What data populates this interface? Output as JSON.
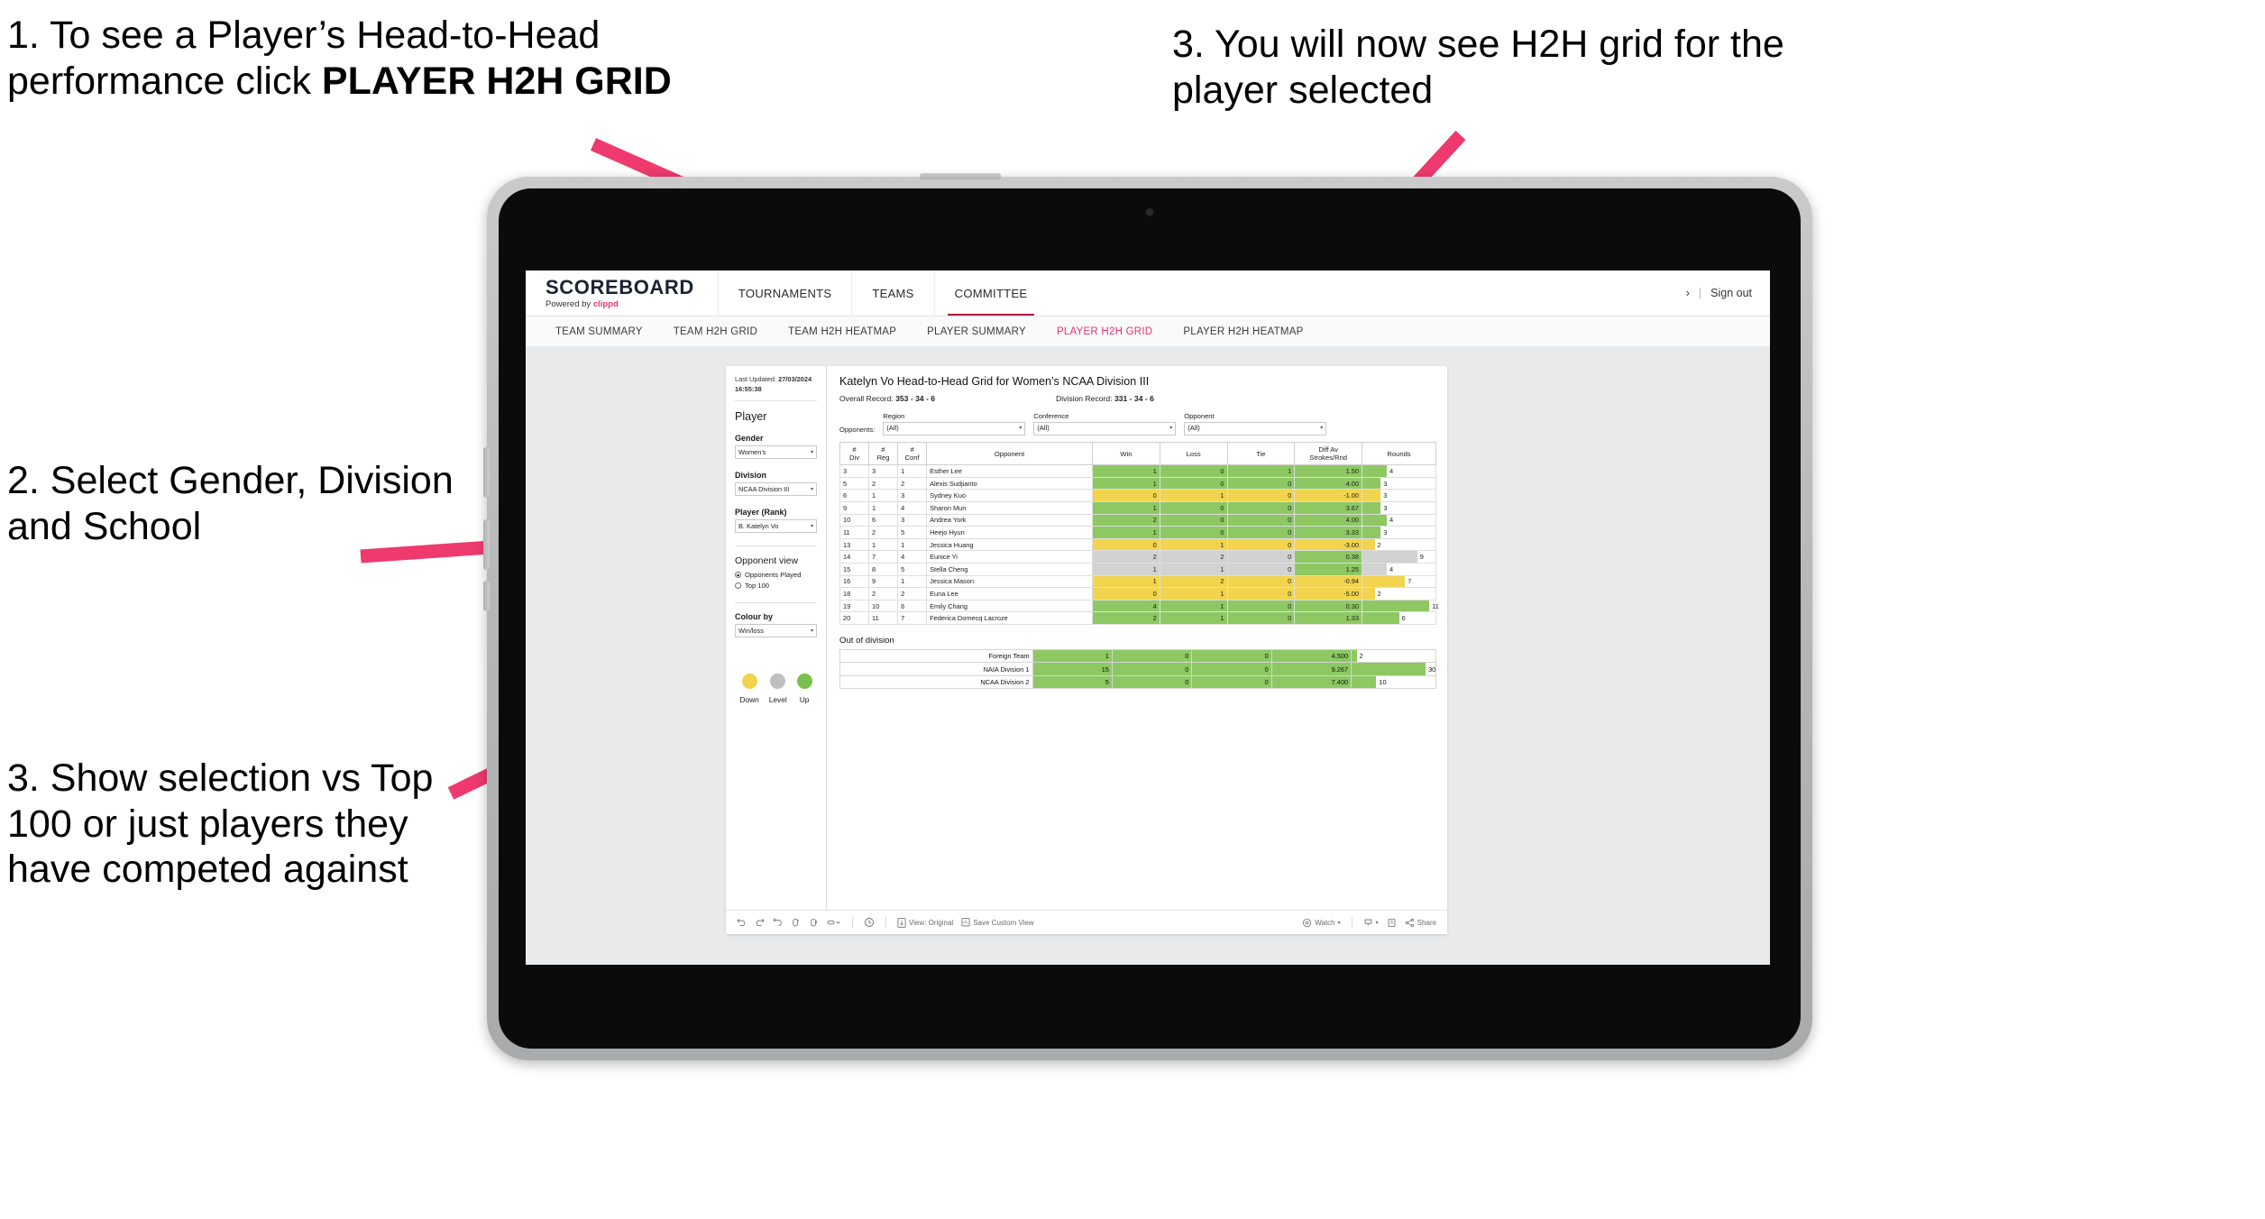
{
  "annotations": [
    {
      "id": "anno-click-player-h2h",
      "text_a": "1. To see a Player’s Head-to-Head performance click ",
      "text_b": "PLAYER H2H GRID"
    },
    {
      "id": "anno-select-filters",
      "text": "2. Select Gender, Division and School"
    },
    {
      "id": "anno-show-selection",
      "text": "3. Show selection vs Top 100 or just players they have competed against"
    },
    {
      "id": "anno-see-grid",
      "text": "3. You will now see H2H grid for the player selected"
    }
  ],
  "app": {
    "brand": {
      "name": "SCOREBOARD",
      "powered_prefix": "Powered by ",
      "powered_brand": "clippd"
    },
    "top_nav": [
      {
        "label": "TOURNAMENTS",
        "active": false
      },
      {
        "label": "TEAMS",
        "active": false
      },
      {
        "label": "COMMITTEE",
        "active": true
      }
    ],
    "top_right": {
      "chevron": "›",
      "separator": "|",
      "sign_out": "Sign out"
    },
    "sub_nav": [
      {
        "label": "TEAM SUMMARY",
        "active": false
      },
      {
        "label": "TEAM H2H GRID",
        "active": false
      },
      {
        "label": "TEAM H2H HEATMAP",
        "active": false
      },
      {
        "label": "PLAYER SUMMARY",
        "active": false
      },
      {
        "label": "PLAYER H2H GRID",
        "active": true
      },
      {
        "label": "PLAYER H2H HEATMAP",
        "active": false
      }
    ]
  },
  "sidebar": {
    "last_updated_label": "Last Updated: ",
    "last_updated_value": "27/03/2024 16:55:38",
    "player_heading": "Player",
    "fields": [
      {
        "label": "Gender",
        "value": "Women's"
      },
      {
        "label": "Division",
        "value": "NCAA Division III"
      },
      {
        "label": "Player (Rank)",
        "value": "B. Katelyn Vo"
      }
    ],
    "opponent_view": {
      "heading": "Opponent view",
      "options": [
        {
          "label": "Opponents Played",
          "selected": true
        },
        {
          "label": "Top 100",
          "selected": false
        }
      ]
    },
    "colour_by": {
      "label": "Colour by",
      "value": "Win/loss"
    },
    "legend": [
      {
        "label": "Down",
        "color": "#F0D44E"
      },
      {
        "label": "Level",
        "color": "#BFBFBF"
      },
      {
        "label": "Up",
        "color": "#78C14C"
      }
    ]
  },
  "main": {
    "title": "Katelyn Vo Head-to-Head Grid for Women’s NCAA Division III",
    "overall_record_label": "Overall Record: ",
    "overall_record_value": "353 - 34 - 6",
    "division_record_label": "Division Record: ",
    "division_record_value": "331 - 34 - 6",
    "opponents_label": "Opponents:",
    "filters": [
      {
        "label": "Region",
        "value": "(All)"
      },
      {
        "label": "Conference",
        "value": "(All)"
      },
      {
        "label": "Opponent",
        "value": "(All)"
      }
    ],
    "columns": [
      "# Div",
      "# Reg",
      "# Conf",
      "Opponent",
      "Win",
      "Loss",
      "Tie",
      "Diff Av Strokes/Rnd",
      "Rounds"
    ],
    "rows": [
      {
        "div": "3",
        "reg": "3",
        "conf": "1",
        "opponent": "Esther Lee",
        "win": "1",
        "loss": "0",
        "tie": "1",
        "diff": "1.50",
        "rounds": "4",
        "color": "up"
      },
      {
        "div": "5",
        "reg": "2",
        "conf": "2",
        "opponent": "Alexis Sudjianto",
        "win": "1",
        "loss": "0",
        "tie": "0",
        "diff": "4.00",
        "rounds": "3",
        "color": "up"
      },
      {
        "div": "6",
        "reg": "1",
        "conf": "3",
        "opponent": "Sydney Kuo",
        "win": "0",
        "loss": "1",
        "tie": "0",
        "diff": "-1.00",
        "rounds": "3",
        "color": "down"
      },
      {
        "div": "9",
        "reg": "1",
        "conf": "4",
        "opponent": "Sharon Mun",
        "win": "1",
        "loss": "0",
        "tie": "0",
        "diff": "3.67",
        "rounds": "3",
        "color": "up"
      },
      {
        "div": "10",
        "reg": "6",
        "conf": "3",
        "opponent": "Andrea York",
        "win": "2",
        "loss": "0",
        "tie": "0",
        "diff": "4.00",
        "rounds": "4",
        "color": "up"
      },
      {
        "div": "11",
        "reg": "2",
        "conf": "5",
        "opponent": "Heejo Hyun",
        "win": "1",
        "loss": "0",
        "tie": "0",
        "diff": "3.33",
        "rounds": "3",
        "color": "up"
      },
      {
        "div": "13",
        "reg": "1",
        "conf": "1",
        "opponent": "Jessica Huang",
        "win": "0",
        "loss": "1",
        "tie": "0",
        "diff": "-3.00",
        "rounds": "2",
        "color": "down"
      },
      {
        "div": "14",
        "reg": "7",
        "conf": "4",
        "opponent": "Eunice Yi",
        "win": "2",
        "loss": "2",
        "tie": "0",
        "diff": "0.38",
        "rounds": "9",
        "color": "level",
        "diff_color": "up"
      },
      {
        "div": "15",
        "reg": "8",
        "conf": "5",
        "opponent": "Stella Cheng",
        "win": "1",
        "loss": "1",
        "tie": "0",
        "diff": "1.25",
        "rounds": "4",
        "color": "level",
        "diff_color": "up"
      },
      {
        "div": "16",
        "reg": "9",
        "conf": "1",
        "opponent": "Jessica Mason",
        "win": "1",
        "loss": "2",
        "tie": "0",
        "diff": "-0.94",
        "rounds": "7",
        "color": "down"
      },
      {
        "div": "18",
        "reg": "2",
        "conf": "2",
        "opponent": "Euna Lee",
        "win": "0",
        "loss": "1",
        "tie": "0",
        "diff": "-5.00",
        "rounds": "2",
        "color": "down"
      },
      {
        "div": "19",
        "reg": "10",
        "conf": "6",
        "opponent": "Emily Chang",
        "win": "4",
        "loss": "1",
        "tie": "0",
        "diff": "0.30",
        "rounds": "11",
        "color": "up"
      },
      {
        "div": "20",
        "reg": "11",
        "conf": "7",
        "opponent": "Federica Domecq Lacroze",
        "win": "2",
        "loss": "1",
        "tie": "0",
        "diff": "1.33",
        "rounds": "6",
        "color": "up"
      }
    ],
    "out_of_division": {
      "title": "Out of division",
      "rows": [
        {
          "name": "Foreign Team",
          "win": "1",
          "loss": "0",
          "tie": "0",
          "diff": "4.500",
          "rounds": "2",
          "color": "up"
        },
        {
          "name": "NAIA Division 1",
          "win": "15",
          "loss": "0",
          "tie": "0",
          "diff": "9.267",
          "rounds": "30",
          "color": "up"
        },
        {
          "name": "NCAA Division 2",
          "win": "5",
          "loss": "0",
          "tie": "0",
          "diff": "7.400",
          "rounds": "10",
          "color": "up"
        }
      ]
    }
  },
  "toolbar": {
    "items": [
      {
        "name": "undo-icon",
        "label": ""
      },
      {
        "name": "redo-icon",
        "label": ""
      },
      {
        "name": "revert-icon",
        "label": ""
      },
      {
        "name": "refresh-icon",
        "label": ""
      },
      {
        "name": "pause-icon",
        "label": ""
      },
      {
        "name": "shape-dropdown-icon",
        "label": ""
      },
      {
        "name": "history-icon",
        "label": ""
      }
    ],
    "view_original": "View: Original",
    "save_custom_view": "Save Custom View",
    "watch": "Watch",
    "share": "Share"
  },
  "colors": {
    "accent_pink": "#E8336D",
    "arrow_pink": "#EE3A6E",
    "cell_up": "#8DC863",
    "cell_down": "#F2D44E",
    "cell_level": "#D2D2D2",
    "bar_up": "#8DC863",
    "bar_down": "#F2D44E",
    "bar_level": "#D2D2D2"
  }
}
